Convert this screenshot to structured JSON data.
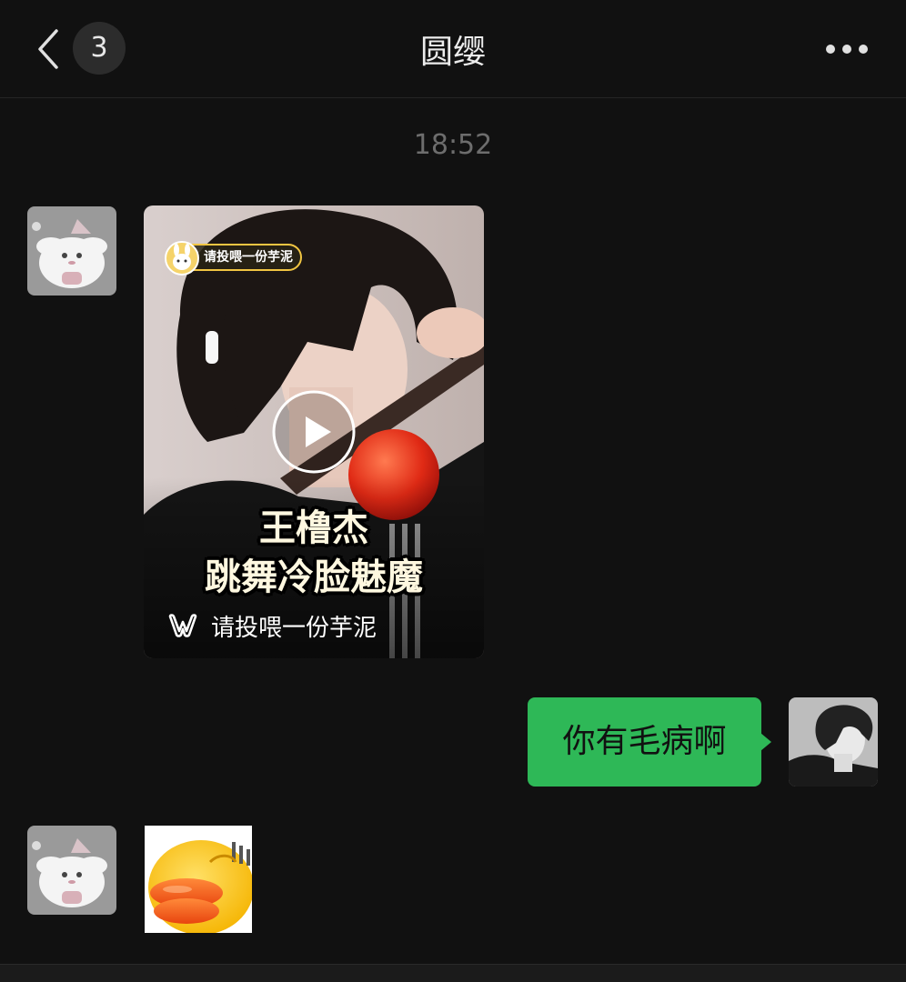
{
  "header": {
    "title": "圆缨",
    "unread_count": "3",
    "back_icon": "chevron-left-icon",
    "more_icon": "more-dots-icon"
  },
  "timestamp": "18:52",
  "messages": [
    {
      "sender": "contact",
      "type": "video",
      "channel_chip": "请投喂一份芋泥",
      "overlay_line1": "王橹杰",
      "overlay_line2": "跳舞冷脸魅魔",
      "channel_name": "请投喂一份芋泥",
      "play_icon": "play-icon",
      "channel_icon": "channels-logo-icon"
    },
    {
      "sender": "me",
      "type": "text",
      "text": "你有毛病啊"
    },
    {
      "sender": "contact",
      "type": "sticker",
      "sticker_icon": "duck-lips-sticker-icon"
    }
  ],
  "colors": {
    "background": "#111111",
    "bubble_green": "#2eb857",
    "timestamp_gray": "#6d6d6d"
  }
}
